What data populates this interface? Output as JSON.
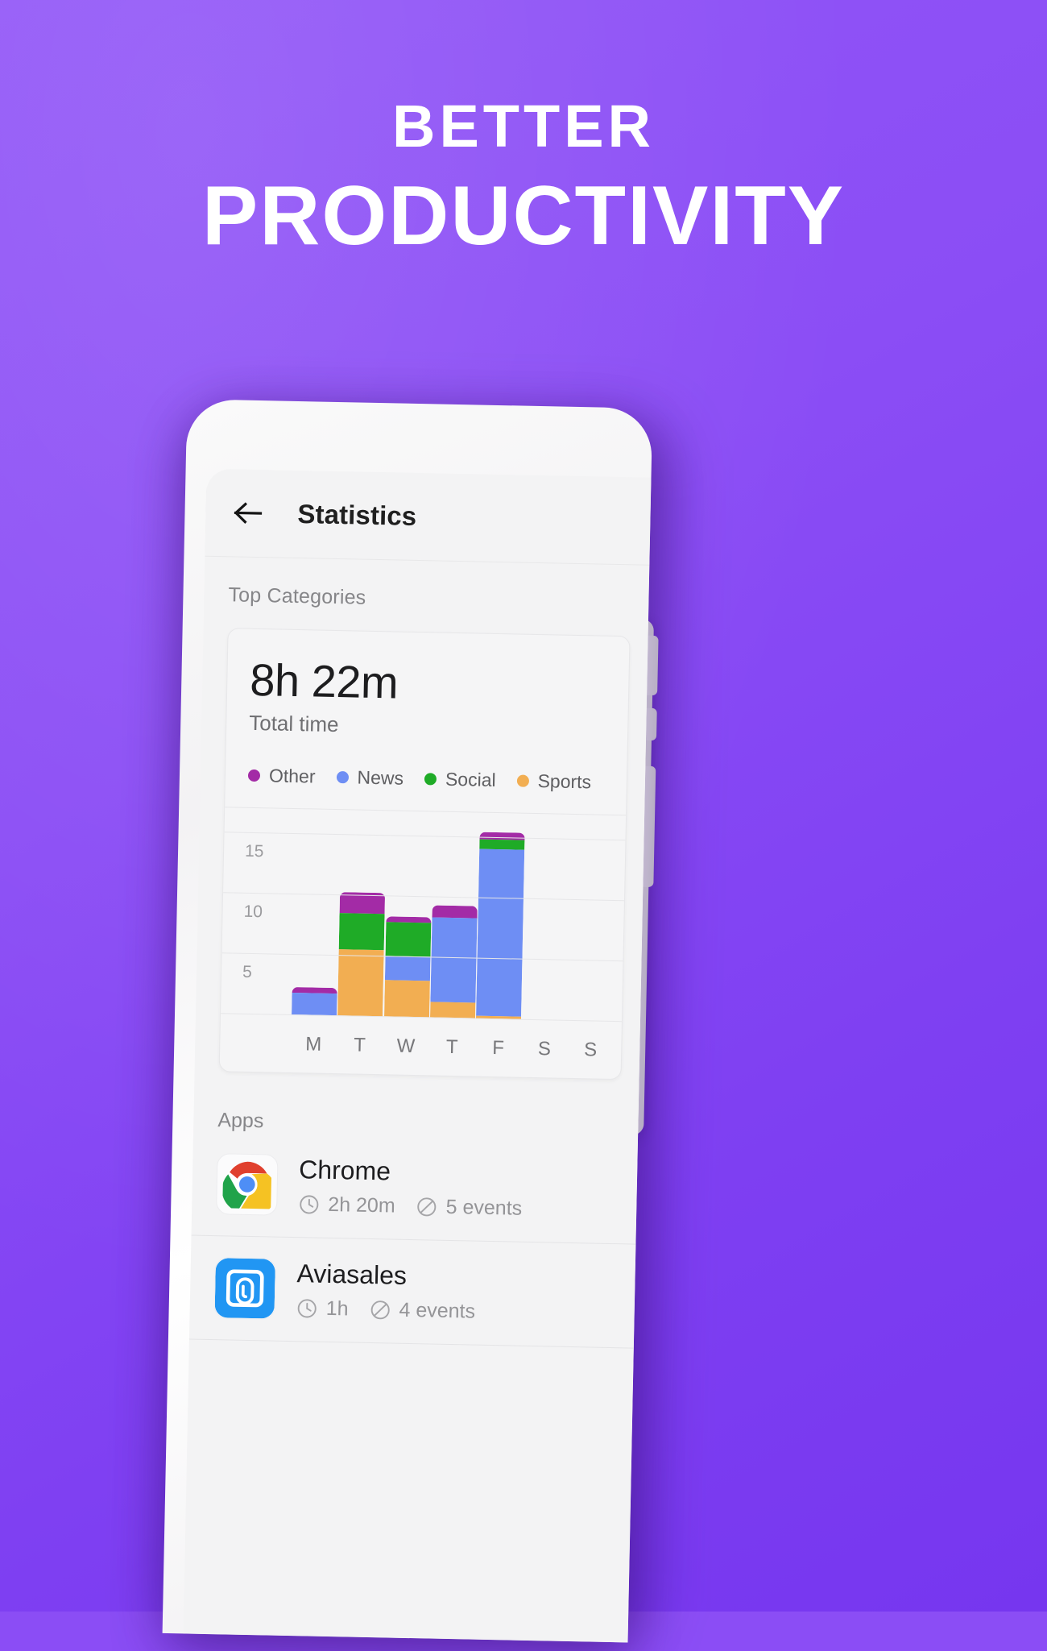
{
  "theme": {
    "bg_purple": "#8b4df5",
    "bg_purple_dark": "#7636ef",
    "headline_color": "#ffffff"
  },
  "headline": {
    "line1": "BETTER",
    "line2": "PRODUCTIVITY"
  },
  "phone": {
    "appbar": {
      "back_icon": "arrow-left-icon",
      "title": "Statistics"
    },
    "sections": {
      "top_categories_label": "Top Categories",
      "apps_label": "Apps"
    },
    "category_card": {
      "total_time_value": "8h 22m",
      "total_time_label": "Total time",
      "legend": [
        {
          "label": "Other",
          "color": "#a32ba6"
        },
        {
          "label": "News",
          "color": "#6e8ef4"
        },
        {
          "label": "Social",
          "color": "#1fab27"
        },
        {
          "label": "Sports",
          "color": "#f2ae52"
        }
      ]
    },
    "apps": [
      {
        "icon": "chrome-icon",
        "name": "Chrome",
        "time_icon": "clock-icon",
        "time": "2h 20m",
        "events_icon": "block-icon",
        "events": "5 events"
      },
      {
        "icon": "aviasales-icon",
        "name": "Aviasales",
        "time_icon": "clock-icon",
        "time": "1h",
        "events_icon": "block-icon",
        "events": "4 events"
      }
    ]
  },
  "chart_data": {
    "type": "bar",
    "stacked": true,
    "title": "Top Categories",
    "xlabel": "",
    "ylabel": "",
    "ylim": [
      0,
      17
    ],
    "yticks": [
      5,
      10,
      15
    ],
    "grid": true,
    "legend_position": "top",
    "categories": [
      "M",
      "T",
      "W",
      "T",
      "F",
      "S",
      "S"
    ],
    "series": [
      {
        "name": "Sports",
        "color": "#f2ae52",
        "values": [
          0,
          5.5,
          3.0,
          1.3,
          0.2,
          0,
          0
        ]
      },
      {
        "name": "News",
        "color": "#6e8ef4",
        "values": [
          1.8,
          0,
          2.0,
          7.0,
          13.8,
          0,
          0
        ]
      },
      {
        "name": "Social",
        "color": "#1fab27",
        "values": [
          0,
          3.0,
          2.8,
          0,
          0.8,
          0,
          0
        ]
      },
      {
        "name": "Other",
        "color": "#a32ba6",
        "values": [
          0.5,
          1.7,
          0.5,
          1.0,
          0.6,
          0,
          0
        ]
      }
    ],
    "totals": [
      2.3,
      10.2,
      8.3,
      9.3,
      15.4,
      0,
      0
    ]
  }
}
